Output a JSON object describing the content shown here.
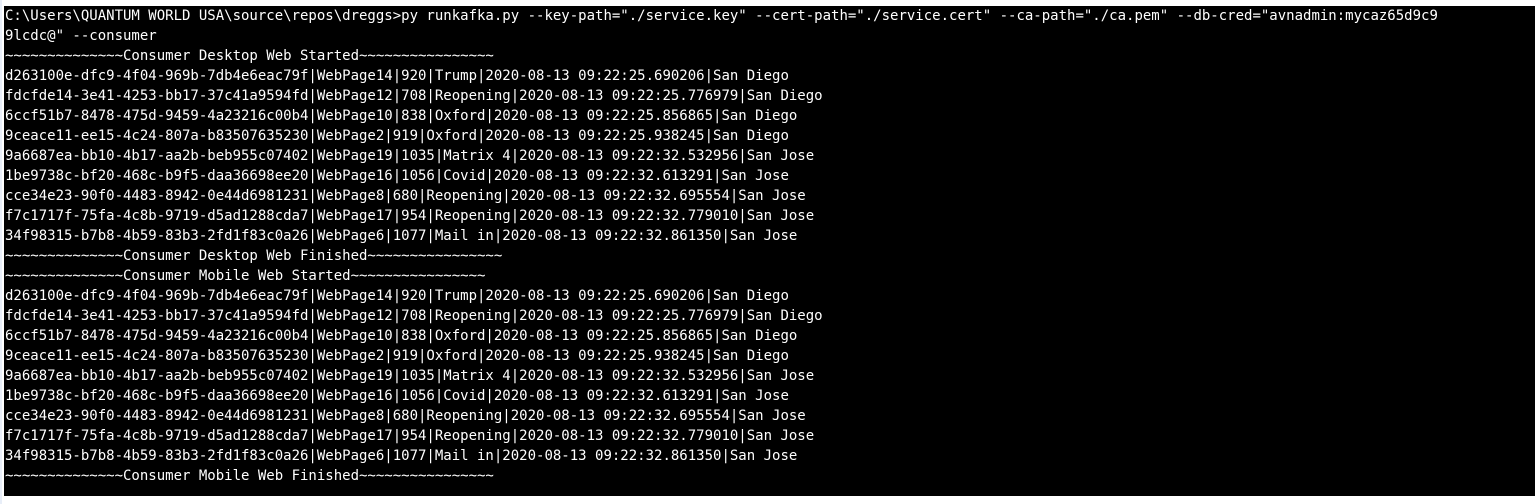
{
  "terminal": {
    "command_line_1": "C:\\Users\\QUANTUM WORLD USA\\source\\repos\\dreggs>py runkafka.py --key-path=\"./service.key\" --cert-path=\"./service.cert\" --ca-path=\"./ca.pem\" --db-cred=\"avnadmin:mycaz65d9c9",
    "command_line_2": "9lcdc@\" --consumer",
    "desktop": {
      "started": "~~~~~~~~~~~~~~Consumer Desktop Web Started~~~~~~~~~~~~~~~~",
      "rows": [
        "d263100e-dfc9-4f04-969b-7db4e6eac79f|WebPage14|920|Trump|2020-08-13 09:22:25.690206|San Diego",
        "fdcfde14-3e41-4253-bb17-37c41a9594fd|WebPage12|708|Reopening|2020-08-13 09:22:25.776979|San Diego",
        "6ccf51b7-8478-475d-9459-4a23216c00b4|WebPage10|838|Oxford|2020-08-13 09:22:25.856865|San Diego",
        "9ceace11-ee15-4c24-807a-b83507635230|WebPage2|919|Oxford|2020-08-13 09:22:25.938245|San Diego",
        "9a6687ea-bb10-4b17-aa2b-beb955c07402|WebPage19|1035|Matrix 4|2020-08-13 09:22:32.532956|San Jose",
        "1be9738c-bf20-468c-b9f5-daa36698ee20|WebPage16|1056|Covid|2020-08-13 09:22:32.613291|San Jose",
        "cce34e23-90f0-4483-8942-0e44d6981231|WebPage8|680|Reopening|2020-08-13 09:22:32.695554|San Jose",
        "f7c1717f-75fa-4c8b-9719-d5ad1288cda7|WebPage17|954|Reopening|2020-08-13 09:22:32.779010|San Jose",
        "34f98315-b7b8-4b59-83b3-2fd1f83c0a26|WebPage6|1077|Mail in|2020-08-13 09:22:32.861350|San Jose"
      ],
      "finished": "~~~~~~~~~~~~~~Consumer Desktop Web Finished~~~~~~~~~~~~~~~~"
    },
    "mobile": {
      "started": "~~~~~~~~~~~~~~Consumer Mobile Web Started~~~~~~~~~~~~~~~~",
      "rows": [
        "d263100e-dfc9-4f04-969b-7db4e6eac79f|WebPage14|920|Trump|2020-08-13 09:22:25.690206|San Diego",
        "fdcfde14-3e41-4253-bb17-37c41a9594fd|WebPage12|708|Reopening|2020-08-13 09:22:25.776979|San Diego",
        "6ccf51b7-8478-475d-9459-4a23216c00b4|WebPage10|838|Oxford|2020-08-13 09:22:25.856865|San Diego",
        "9ceace11-ee15-4c24-807a-b83507635230|WebPage2|919|Oxford|2020-08-13 09:22:25.938245|San Diego",
        "9a6687ea-bb10-4b17-aa2b-beb955c07402|WebPage19|1035|Matrix 4|2020-08-13 09:22:32.532956|San Jose",
        "1be9738c-bf20-468c-b9f5-daa36698ee20|WebPage16|1056|Covid|2020-08-13 09:22:32.613291|San Jose",
        "cce34e23-90f0-4483-8942-0e44d6981231|WebPage8|680|Reopening|2020-08-13 09:22:32.695554|San Jose",
        "f7c1717f-75fa-4c8b-9719-d5ad1288cda7|WebPage17|954|Reopening|2020-08-13 09:22:32.779010|San Jose",
        "34f98315-b7b8-4b59-83b3-2fd1f83c0a26|WebPage6|1077|Mail in|2020-08-13 09:22:32.861350|San Jose"
      ],
      "finished": "~~~~~~~~~~~~~~Consumer Mobile Web Finished~~~~~~~~~~~~~~~~"
    }
  },
  "colors": {
    "console_background": "#000000",
    "console_text": "#ffffff"
  }
}
